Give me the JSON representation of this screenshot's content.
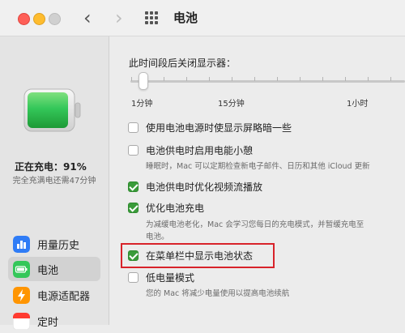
{
  "window": {
    "title": "电池"
  },
  "sidebar": {
    "status": {
      "charging": "正在充电：91%",
      "time_to_full": "完全充满电还需47分钟"
    },
    "items": [
      {
        "label": "用量历史",
        "icon": "bar-chart-icon",
        "color": "#2f7cf6"
      },
      {
        "label": "电池",
        "icon": "battery-icon",
        "color": "#34c759"
      },
      {
        "label": "电源适配器",
        "icon": "power-adapter-icon",
        "color": "#ff9500"
      },
      {
        "label": "定时",
        "icon": "calendar-icon",
        "color": "#ff3b30"
      }
    ]
  },
  "main": {
    "display_off_slider": {
      "label": "此时间段后关闭显示器：",
      "ticks": [
        "1分钟",
        "15分钟",
        "1小时"
      ]
    },
    "options": [
      {
        "label": "使用电池电源时使显示屏略暗一些",
        "checked": false
      },
      {
        "label": "电池供电时启用电能小憩",
        "checked": false,
        "desc": "睡眠时，Mac 可以定期检查新电子邮件、日历和其他 iCloud 更新"
      },
      {
        "label": "电池供电时优化视频流播放",
        "checked": true
      },
      {
        "label": "优化电池充电",
        "checked": true,
        "desc": "为减缓电池老化，Mac 会学习您每日的充电模式，并暂缓充电至",
        "desc2": "电池。"
      },
      {
        "label": "在菜单栏中显示电池状态",
        "checked": true
      },
      {
        "label": "低电量模式",
        "checked": false,
        "desc": "您的 Mac 将减少电量使用以提高电池续航"
      }
    ]
  },
  "colors": {
    "checkbox_checked": "#3a9b3a",
    "highlight": "#d8232a",
    "battery_fill": "#34c759"
  }
}
